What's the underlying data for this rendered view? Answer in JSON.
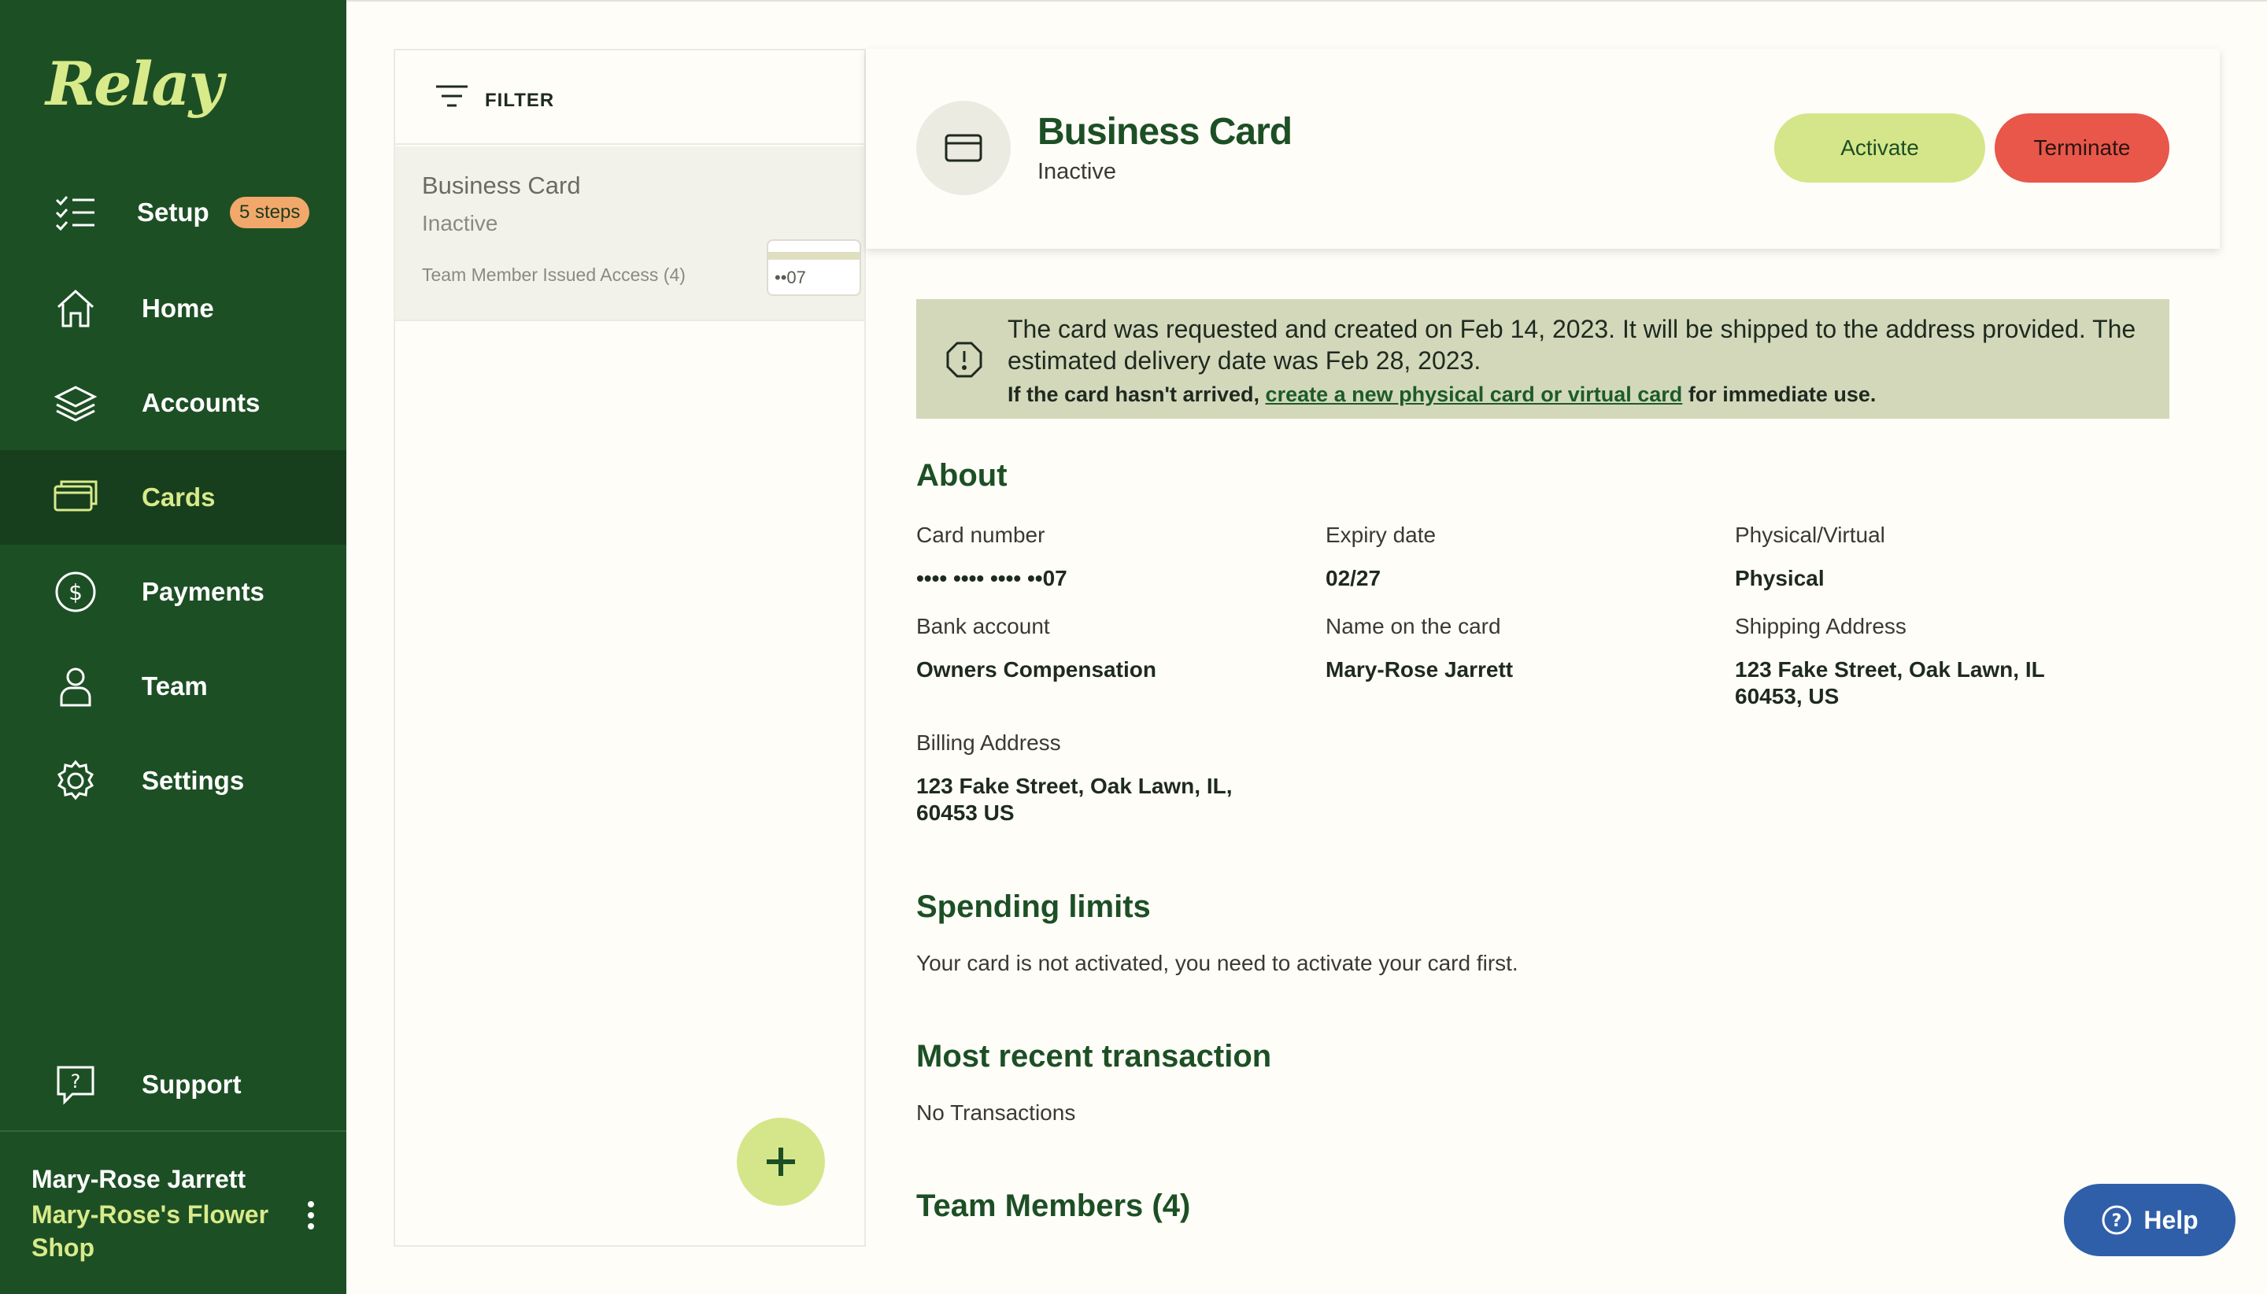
{
  "brand": {
    "logo_text": "Relay"
  },
  "sidebar": {
    "items": [
      {
        "label": "Setup",
        "icon": "checklist-icon",
        "badge": "5 steps"
      },
      {
        "label": "Home",
        "icon": "home-icon"
      },
      {
        "label": "Accounts",
        "icon": "layers-icon"
      },
      {
        "label": "Cards",
        "icon": "card-icon",
        "active": true
      },
      {
        "label": "Payments",
        "icon": "dollar-circle-icon"
      },
      {
        "label": "Team",
        "icon": "person-icon"
      },
      {
        "label": "Settings",
        "icon": "gear-icon"
      },
      {
        "label": "Support",
        "icon": "support-question-icon"
      }
    ],
    "user": {
      "name": "Mary-Rose Jarrett",
      "org": "Mary-Rose's Flower Shop"
    }
  },
  "list": {
    "filter_label": "FILTER",
    "card": {
      "name": "Business Card",
      "status": "Inactive",
      "access": "Team Member Issued Access (4)",
      "last4": "••07"
    }
  },
  "detail": {
    "title": "Business Card",
    "status": "Inactive",
    "activate_label": "Activate",
    "terminate_label": "Terminate",
    "notice": {
      "text": "The card was requested and created on Feb 14, 2023. It will be shipped to the address provided. The estimated delivery date was Feb 28, 2023.",
      "sub_prefix": "If the card hasn't arrived,",
      "sub_link": "create a new physical card or virtual card",
      "sub_suffix": "for immediate use."
    },
    "about": {
      "title": "About",
      "card_number_label": "Card number",
      "card_number": "•••• •••• •••• ••07",
      "expiry_label": "Expiry date",
      "expiry": "02/27",
      "type_label": "Physical/Virtual",
      "type": "Physical",
      "bank_label": "Bank account",
      "bank": "Owners Compensation",
      "name_label": "Name on the card",
      "name": "Mary-Rose Jarrett",
      "shipping_label": "Shipping Address",
      "shipping_line1": "123 Fake Street, Oak Lawn, IL",
      "shipping_line2": "60453, US",
      "billing_label": "Billing Address",
      "billing_line1": "123 Fake Street, Oak Lawn, IL,",
      "billing_line2": "60453 US"
    },
    "spending": {
      "title": "Spending limits",
      "text": "Your card is not activated, you need to activate your card first."
    },
    "recent": {
      "title": "Most recent transaction",
      "text": "No Transactions"
    },
    "team": {
      "title": "Team Members (4)"
    }
  },
  "help": {
    "label": "Help"
  },
  "colors": {
    "sidebar": "#1d4f25",
    "accent": "#d5e68a",
    "danger": "#e8574a",
    "help": "#2f5fa8"
  }
}
